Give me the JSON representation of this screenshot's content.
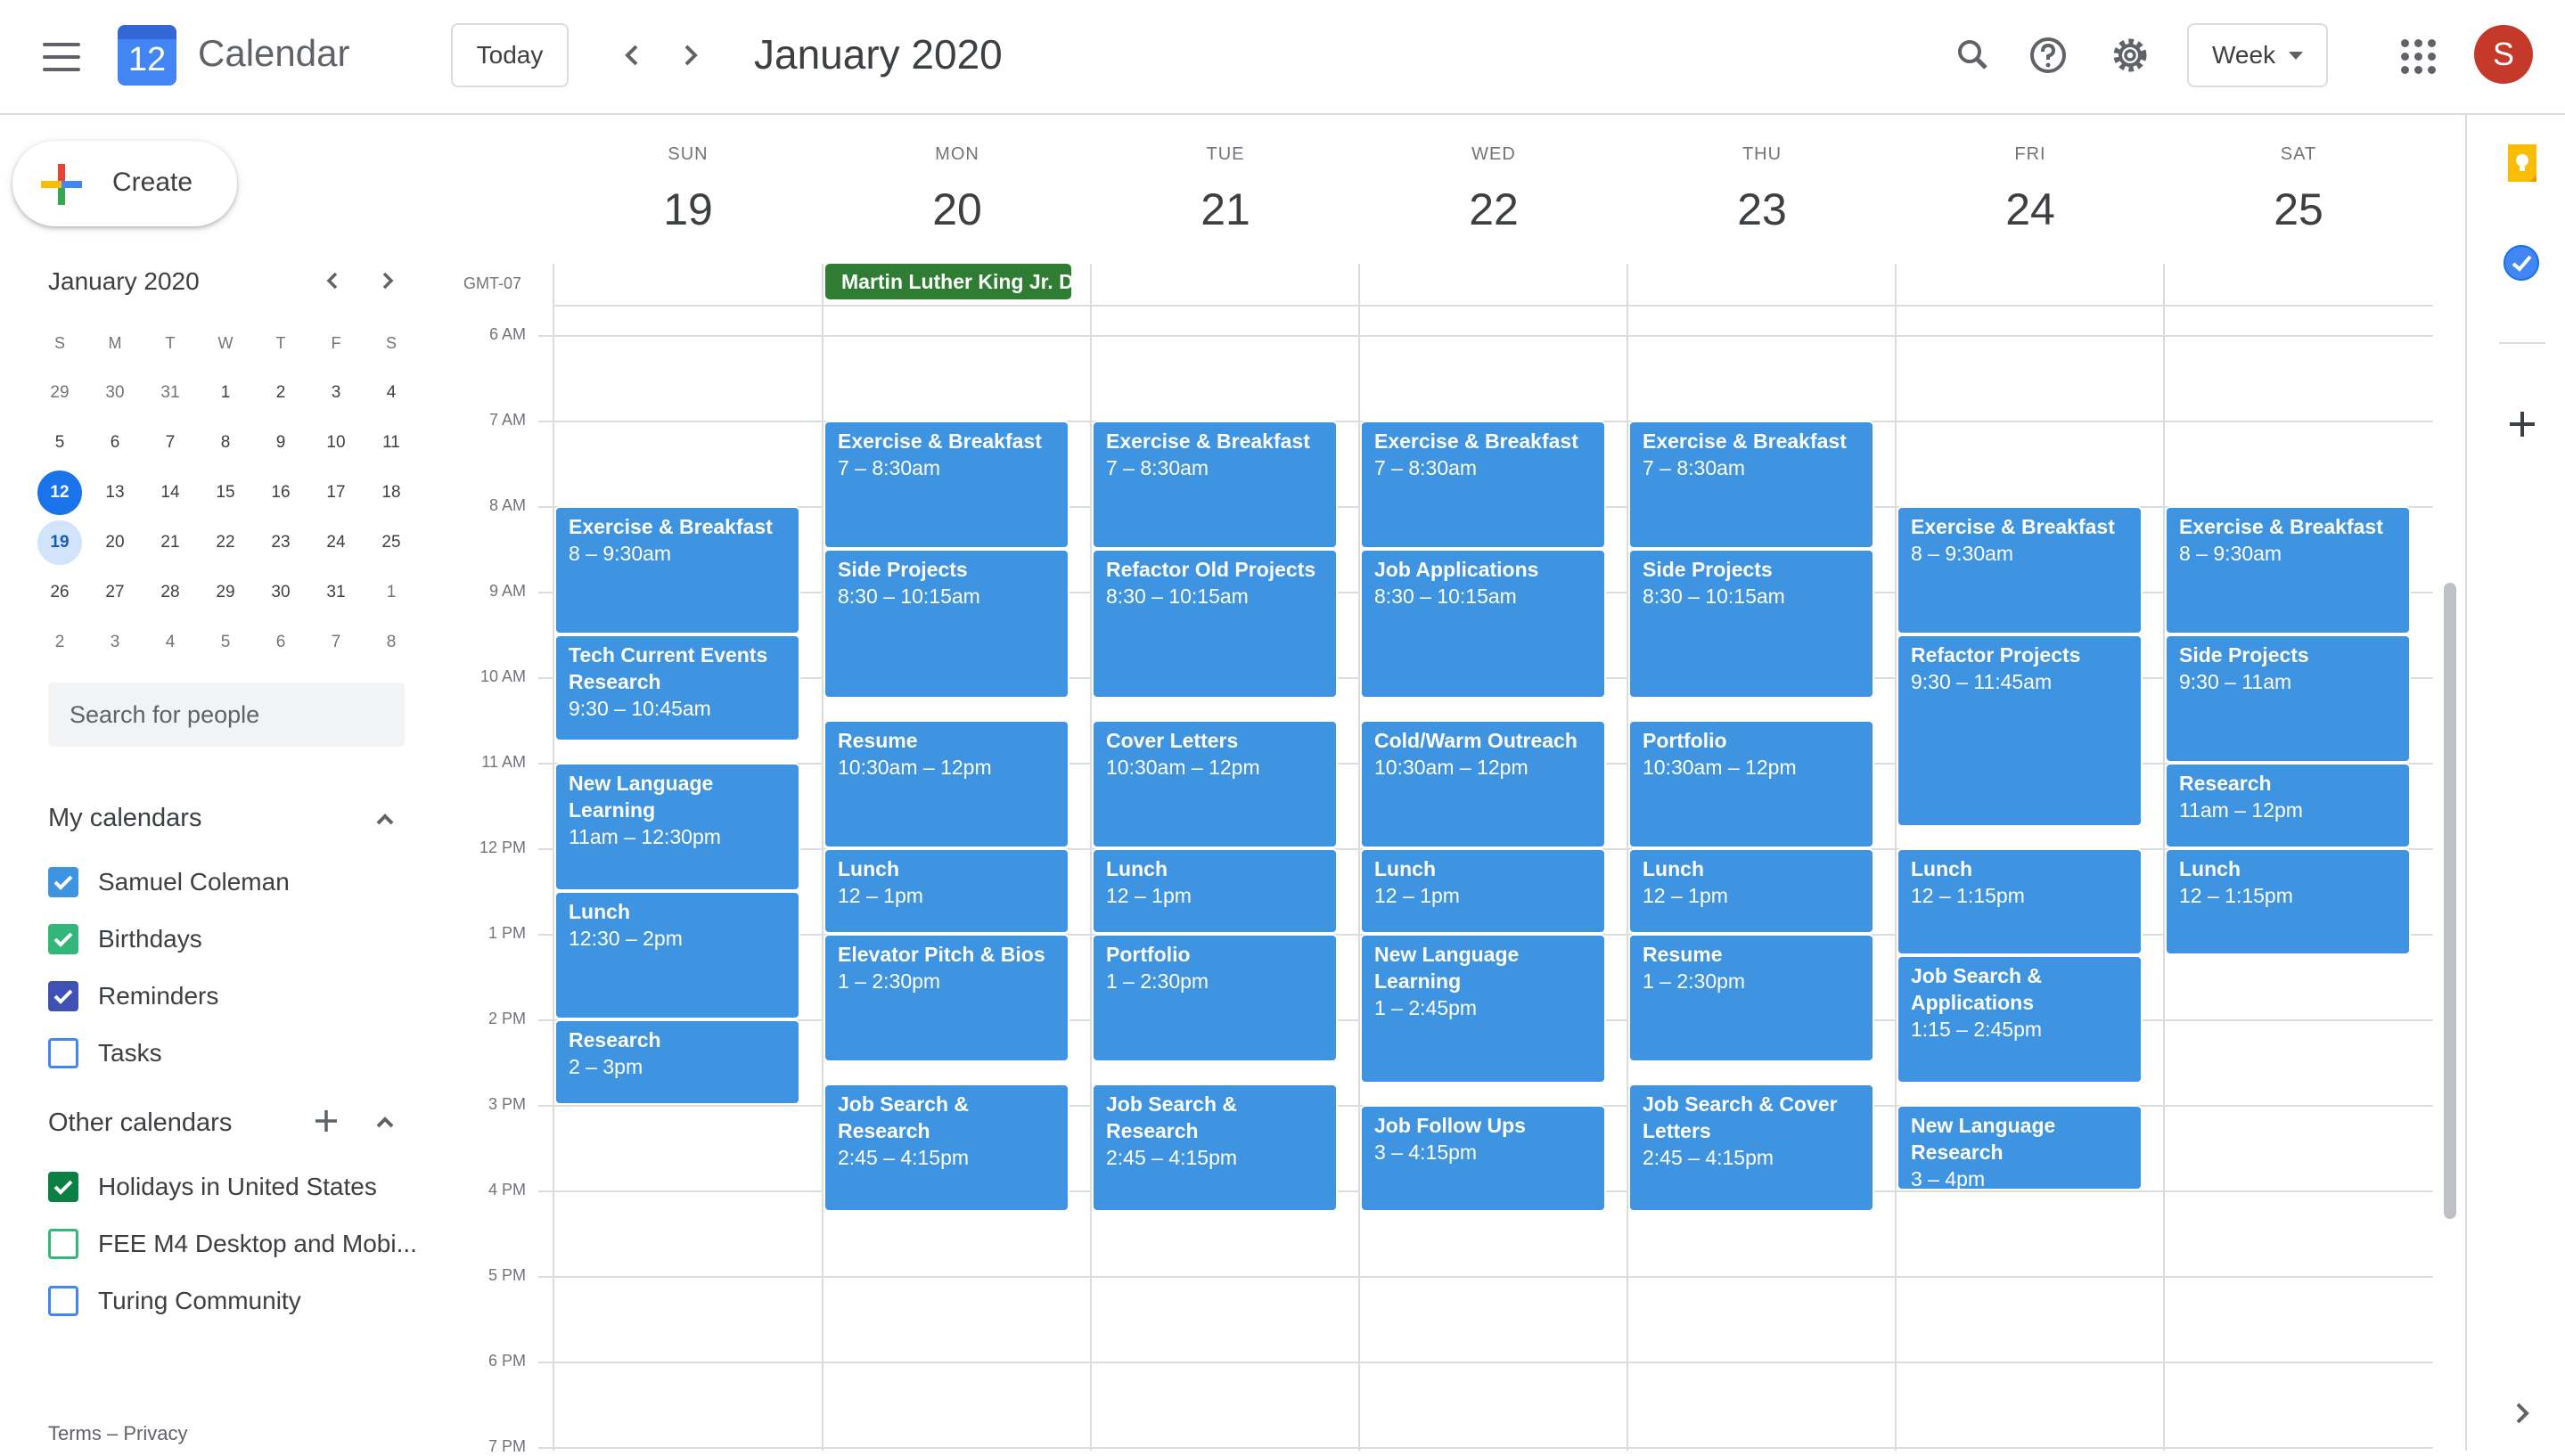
{
  "app": {
    "name": "Calendar",
    "logo_day": "12",
    "today_button": "Today",
    "current_range": "January 2020",
    "view_selector": "Week",
    "avatar_letter": "S",
    "accent_color": "#1a73e8",
    "event_color": "#3f94e2",
    "holiday_color": "#2e7d32",
    "avatar_color": "#c5392a"
  },
  "icons": {
    "menu": "hamburger-menu-icon",
    "prev": "chevron-left-icon",
    "next": "chevron-right-icon",
    "search": "search-icon",
    "help": "help-icon",
    "settings": "gear-icon",
    "apps": "apps-grid-icon"
  },
  "sidebar": {
    "create_label": "Create",
    "mini_calendar": {
      "title": "January 2020",
      "weekday_headers": [
        "S",
        "M",
        "T",
        "W",
        "T",
        "F",
        "S"
      ],
      "weeks": [
        [
          "29",
          "30",
          "31",
          "1",
          "2",
          "3",
          "4"
        ],
        [
          "5",
          "6",
          "7",
          "8",
          "9",
          "10",
          "11"
        ],
        [
          "12",
          "13",
          "14",
          "15",
          "16",
          "17",
          "18"
        ],
        [
          "19",
          "20",
          "21",
          "22",
          "23",
          "24",
          "25"
        ],
        [
          "26",
          "27",
          "28",
          "29",
          "30",
          "31",
          "1"
        ],
        [
          "2",
          "3",
          "4",
          "5",
          "6",
          "7",
          "8"
        ]
      ],
      "today": "12",
      "selected": "19"
    },
    "search_people_placeholder": "Search for people",
    "my_calendars_title": "My calendars",
    "my_calendars": [
      {
        "name": "Samuel Coleman",
        "color": "#3f94e2",
        "checked": true
      },
      {
        "name": "Birthdays",
        "color": "#33b679",
        "checked": true
      },
      {
        "name": "Reminders",
        "color": "#3f51b5",
        "checked": true
      },
      {
        "name": "Tasks",
        "color": "#4285f4",
        "checked": false
      }
    ],
    "other_calendars_title": "Other calendars",
    "other_calendars": [
      {
        "name": "Holidays in United States",
        "color": "#0b8043",
        "checked": true
      },
      {
        "name": "FEE M4 Desktop and Mobi...",
        "color": "#33b679",
        "checked": false
      },
      {
        "name": "Turing Community",
        "color": "#4285f4",
        "checked": false
      }
    ],
    "footer": "Terms – Privacy"
  },
  "week": {
    "timezone": "GMT-07",
    "days": [
      {
        "dow": "SUN",
        "num": "19"
      },
      {
        "dow": "MON",
        "num": "20"
      },
      {
        "dow": "TUE",
        "num": "21"
      },
      {
        "dow": "WED",
        "num": "22"
      },
      {
        "dow": "THU",
        "num": "23"
      },
      {
        "dow": "FRI",
        "num": "24"
      },
      {
        "dow": "SAT",
        "num": "25"
      }
    ],
    "hours": [
      "6 AM",
      "7 AM",
      "8 AM",
      "9 AM",
      "10 AM",
      "11 AM",
      "12 PM",
      "1 PM",
      "2 PM",
      "3 PM",
      "4 PM",
      "5 PM",
      "6 PM",
      "7 PM"
    ],
    "all_day_events": [
      {
        "day": 1,
        "title": "Martin Luther King Jr. Day"
      }
    ],
    "events": [
      {
        "day": 0,
        "title": "Exercise & Breakfast",
        "time": "8 – 9:30am",
        "start": 8,
        "end": 9.5
      },
      {
        "day": 0,
        "title": "Tech Current Events Research",
        "time": "9:30 – 10:45am",
        "start": 9.5,
        "end": 10.75
      },
      {
        "day": 0,
        "title": "New Language Learning",
        "time": "11am – 12:30pm",
        "start": 11,
        "end": 12.5
      },
      {
        "day": 0,
        "title": "Lunch",
        "time": "12:30 – 2pm",
        "start": 12.5,
        "end": 14
      },
      {
        "day": 0,
        "title": "Research",
        "time": "2 – 3pm",
        "start": 14,
        "end": 15
      },
      {
        "day": 1,
        "title": "Exercise & Breakfast",
        "time": "7 – 8:30am",
        "start": 7,
        "end": 8.5
      },
      {
        "day": 1,
        "title": "Side Projects",
        "time": "8:30 – 10:15am",
        "start": 8.5,
        "end": 10.25
      },
      {
        "day": 1,
        "title": "Resume",
        "time": "10:30am – 12pm",
        "start": 10.5,
        "end": 12
      },
      {
        "day": 1,
        "title": "Lunch",
        "time": "12 – 1pm",
        "start": 12,
        "end": 13
      },
      {
        "day": 1,
        "title": "Elevator Pitch & Bios",
        "time": "1 – 2:30pm",
        "start": 13,
        "end": 14.5
      },
      {
        "day": 1,
        "title": "Job Search & Research",
        "time": "2:45 – 4:15pm",
        "start": 14.75,
        "end": 16.25
      },
      {
        "day": 2,
        "title": "Exercise & Breakfast",
        "time": "7 – 8:30am",
        "start": 7,
        "end": 8.5
      },
      {
        "day": 2,
        "title": "Refactor Old Projects",
        "time": "8:30 – 10:15am",
        "start": 8.5,
        "end": 10.25
      },
      {
        "day": 2,
        "title": "Cover Letters",
        "time": "10:30am – 12pm",
        "start": 10.5,
        "end": 12
      },
      {
        "day": 2,
        "title": "Lunch",
        "time": "12 – 1pm",
        "start": 12,
        "end": 13
      },
      {
        "day": 2,
        "title": "Portfolio",
        "time": "1 – 2:30pm",
        "start": 13,
        "end": 14.5
      },
      {
        "day": 2,
        "title": "Job Search & Research",
        "time": "2:45 – 4:15pm",
        "start": 14.75,
        "end": 16.25
      },
      {
        "day": 3,
        "title": "Exercise & Breakfast",
        "time": "7 – 8:30am",
        "start": 7,
        "end": 8.5
      },
      {
        "day": 3,
        "title": "Job Applications",
        "time": "8:30 – 10:15am",
        "start": 8.5,
        "end": 10.25
      },
      {
        "day": 3,
        "title": "Cold/Warm Outreach",
        "time": "10:30am – 12pm",
        "start": 10.5,
        "end": 12
      },
      {
        "day": 3,
        "title": "Lunch",
        "time": "12 – 1pm",
        "start": 12,
        "end": 13
      },
      {
        "day": 3,
        "title": "New Language Learning",
        "time": "1 – 2:45pm",
        "start": 13,
        "end": 14.75
      },
      {
        "day": 3,
        "title": "Job Follow Ups",
        "time": "3 – 4:15pm",
        "start": 15,
        "end": 16.25
      },
      {
        "day": 4,
        "title": "Exercise & Breakfast",
        "time": "7 – 8:30am",
        "start": 7,
        "end": 8.5
      },
      {
        "day": 4,
        "title": "Side Projects",
        "time": "8:30 – 10:15am",
        "start": 8.5,
        "end": 10.25
      },
      {
        "day": 4,
        "title": "Portfolio",
        "time": "10:30am – 12pm",
        "start": 10.5,
        "end": 12
      },
      {
        "day": 4,
        "title": "Lunch",
        "time": "12 – 1pm",
        "start": 12,
        "end": 13
      },
      {
        "day": 4,
        "title": "Resume",
        "time": "1 – 2:30pm",
        "start": 13,
        "end": 14.5
      },
      {
        "day": 4,
        "title": "Job Search & Cover Letters",
        "time": "2:45 – 4:15pm",
        "start": 14.75,
        "end": 16.25
      },
      {
        "day": 5,
        "title": "Exercise & Breakfast",
        "time": "8 – 9:30am",
        "start": 8,
        "end": 9.5
      },
      {
        "day": 5,
        "title": "Refactor Projects",
        "time": "9:30 – 11:45am",
        "start": 9.5,
        "end": 11.75
      },
      {
        "day": 5,
        "title": "Lunch",
        "time": "12 – 1:15pm",
        "start": 12,
        "end": 13.25
      },
      {
        "day": 5,
        "title": "Job Search & Applications",
        "time": "1:15 – 2:45pm",
        "start": 13.25,
        "end": 14.75
      },
      {
        "day": 5,
        "title": "New Language Research",
        "time": "3 – 4pm",
        "start": 15,
        "end": 16
      },
      {
        "day": 6,
        "title": "Exercise & Breakfast",
        "time": "8 – 9:30am",
        "start": 8,
        "end": 9.5
      },
      {
        "day": 6,
        "title": "Side Projects",
        "time": "9:30 – 11am",
        "start": 9.5,
        "end": 11
      },
      {
        "day": 6,
        "title": "Research",
        "time": "11am – 12pm",
        "start": 11,
        "end": 12
      },
      {
        "day": 6,
        "title": "Lunch",
        "time": "12 – 1:15pm",
        "start": 12,
        "end": 13.25
      }
    ]
  },
  "right_rail": {
    "icons": [
      "keep-icon",
      "tasks-icon",
      "add-addon-icon",
      "expand-panel-icon"
    ]
  }
}
